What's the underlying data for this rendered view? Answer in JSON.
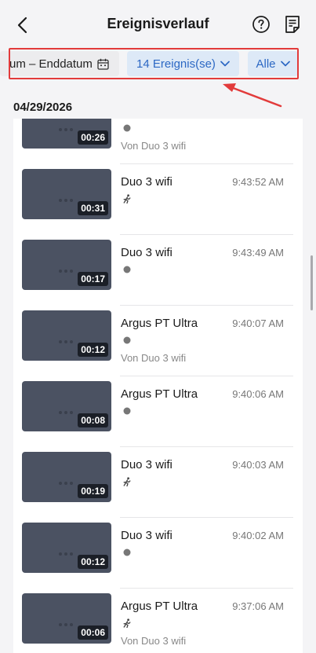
{
  "header": {
    "title": "Ereignisverlauf"
  },
  "filters": {
    "date_range": "um – Enddatum",
    "events": "14 Ereignis(se)",
    "device": "Alle"
  },
  "section_date": "04/29/2026",
  "events": [
    {
      "duration": "00:26",
      "camera": "",
      "time": "",
      "icon": "dot-icon",
      "subtitle": "Von Duo 3 wifi"
    },
    {
      "duration": "00:31",
      "camera": "Duo 3 wifi",
      "time": "9:43:52 AM",
      "icon": "person-icon",
      "subtitle": ""
    },
    {
      "duration": "00:17",
      "camera": "Duo 3 wifi",
      "time": "9:43:49 AM",
      "icon": "dot-icon",
      "subtitle": ""
    },
    {
      "duration": "00:12",
      "camera": "Argus PT Ultra",
      "time": "9:40:07 AM",
      "icon": "dot-icon",
      "subtitle": "Von Duo 3 wifi"
    },
    {
      "duration": "00:08",
      "camera": "Argus PT Ultra",
      "time": "9:40:06 AM",
      "icon": "dot-icon",
      "subtitle": ""
    },
    {
      "duration": "00:19",
      "camera": "Duo 3 wifi",
      "time": "9:40:03 AM",
      "icon": "person-icon",
      "subtitle": ""
    },
    {
      "duration": "00:12",
      "camera": "Duo 3 wifi",
      "time": "9:40:02 AM",
      "icon": "dot-icon",
      "subtitle": ""
    },
    {
      "duration": "00:06",
      "camera": "Argus PT Ultra",
      "time": "9:37:06 AM",
      "icon": "person-icon",
      "subtitle": "Von Duo 3 wifi"
    }
  ],
  "colors": {
    "accent": "#2c68c4",
    "accent_bg": "#dde9f7",
    "annotation": "#e23b3b",
    "thumbnail": "#4b5262"
  }
}
